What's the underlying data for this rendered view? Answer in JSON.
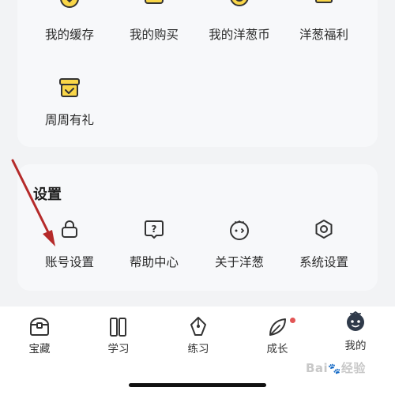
{
  "services": {
    "items": [
      {
        "label": "我的缓存",
        "icon": "download-icon"
      },
      {
        "label": "我的购买",
        "icon": "shopping-bag-icon"
      },
      {
        "label": "我的洋葱币",
        "icon": "coin-icon"
      },
      {
        "label": "洋葱福利",
        "icon": "gift-icon"
      },
      {
        "label": "周周有礼",
        "icon": "gift-box-check-icon"
      }
    ]
  },
  "settings": {
    "title": "设置",
    "items": [
      {
        "label": "账号设置",
        "icon": "lock-icon"
      },
      {
        "label": "帮助中心",
        "icon": "help-bubble-icon"
      },
      {
        "label": "关于洋葱",
        "icon": "onion-face-icon"
      },
      {
        "label": "系统设置",
        "icon": "gear-hex-icon"
      }
    ]
  },
  "tabbar": {
    "tabs": [
      {
        "label": "宝藏",
        "icon": "treasure-chest-icon"
      },
      {
        "label": "学习",
        "icon": "books-icon"
      },
      {
        "label": "练习",
        "icon": "pen-icon"
      },
      {
        "label": "成长",
        "icon": "leaf-icon",
        "badge": true
      },
      {
        "label": "我的",
        "icon": "onion-avatar-icon",
        "active": true
      }
    ]
  },
  "watermark": {
    "text": "Bai",
    "suffix": "经验"
  },
  "colors": {
    "accent_yellow": "#f9d648",
    "icon_stroke": "#333333",
    "badge_red": "#e25555",
    "arrow_red": "#b52a2a",
    "avatar_dark": "#2f3a4a"
  }
}
